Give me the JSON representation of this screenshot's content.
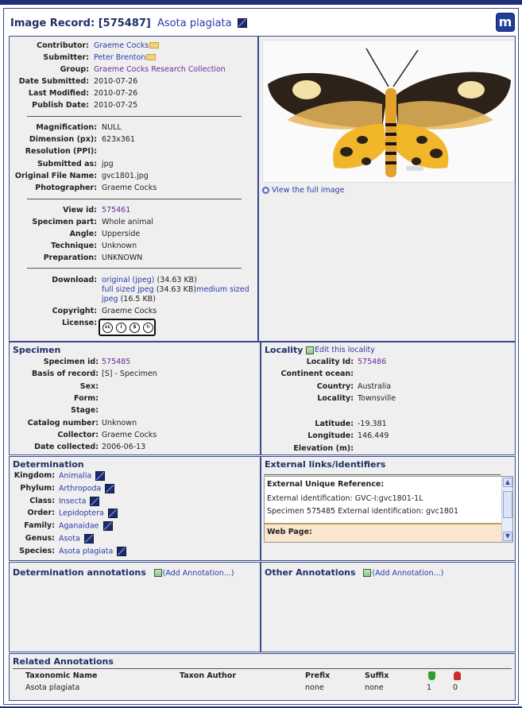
{
  "header": {
    "title": "Image Record: [575487]",
    "scientific_name": "Asota plagiata"
  },
  "record": {
    "contributor": {
      "label": "Contributor:",
      "value": "Graeme Cocks"
    },
    "submitter": {
      "label": "Submitter:",
      "value": "Peter Brenton"
    },
    "group": {
      "label": "Group:",
      "value": "Graeme Cocks Research Collection"
    },
    "date_submitted": {
      "label": "Date Submitted:",
      "value": "2010-07-26"
    },
    "last_modified": {
      "label": "Last Modified:",
      "value": "2010-07-26"
    },
    "publish_date": {
      "label": "Publish Date:",
      "value": "2010-07-25"
    },
    "magnification": {
      "label": "Magnification:",
      "value": "NULL"
    },
    "dimension": {
      "label": "Dimension (px):",
      "value": "623x361"
    },
    "resolution": {
      "label": "Resolution (PPI):",
      "value": ""
    },
    "submitted_as": {
      "label": "Submitted as:",
      "value": "jpg"
    },
    "original_file": {
      "label": "Original File Name:",
      "value": "gvc1801.jpg"
    },
    "photographer": {
      "label": "Photographer:",
      "value": "Graeme Cocks"
    },
    "view_id": {
      "label": "View id:",
      "value": "575461"
    },
    "specimen_part": {
      "label": "Specimen part:",
      "value": "Whole animal"
    },
    "angle": {
      "label": "Angle:",
      "value": "Upperside"
    },
    "technique": {
      "label": "Technique:",
      "value": "Unknown"
    },
    "preparation": {
      "label": "Preparation:",
      "value": "UNKNOWN"
    },
    "download": {
      "label": "Download:",
      "original_link": "original (jpeg)",
      "original_size": "(34.63 KB)",
      "full_link": "full sized jpeg",
      "full_size": "(34.63 KB)",
      "medium_link_1": "medium sized",
      "medium_link_2": "jpeg",
      "medium_size": "(16.5 KB)"
    },
    "copyright": {
      "label": "Copyright:",
      "value": "Graeme Cocks"
    },
    "license": {
      "label": "License:",
      "badge_text": "BY NC SA"
    }
  },
  "image_panel": {
    "view_full_label": "View the full image"
  },
  "specimen": {
    "title": "Specimen",
    "rows": [
      {
        "label": "Specimen id:",
        "value": "575485",
        "link": true
      },
      {
        "label": "Basis of record:",
        "value": "[S] - Specimen",
        "link": false
      },
      {
        "label": "Sex:",
        "value": "",
        "link": false
      },
      {
        "label": "Form:",
        "value": "",
        "link": false
      },
      {
        "label": "Stage:",
        "value": "",
        "link": false
      },
      {
        "label": "Catalog number:",
        "value": "Unknown",
        "link": false
      },
      {
        "label": "Collector:",
        "value": "Graeme Cocks",
        "link": false
      },
      {
        "label": "Date collected:",
        "value": "2006-06-13",
        "link": false
      }
    ]
  },
  "locality": {
    "title": "Locality",
    "edit_label": "Edit this locality",
    "rows": [
      {
        "label": "Locality Id:",
        "value": "575486",
        "link": true
      },
      {
        "label": "Continent ocean:",
        "value": "",
        "link": false
      },
      {
        "label": "Country:",
        "value": "Australia",
        "link": false
      },
      {
        "label": "Locality:",
        "value": "Townsville",
        "link": false
      }
    ],
    "coords": [
      {
        "label": "Latitude:",
        "value": "-19.381"
      },
      {
        "label": "Longitude:",
        "value": "146.449"
      },
      {
        "label": "Elevation (m):",
        "value": ""
      }
    ]
  },
  "determination": {
    "title": "Determination",
    "rows": [
      {
        "label": "Kingdom:",
        "value": "Animalia"
      },
      {
        "label": "Phylum:",
        "value": "Arthropoda"
      },
      {
        "label": "Class:",
        "value": "Insecta"
      },
      {
        "label": "Order:",
        "value": "Lepidoptera"
      },
      {
        "label": "Family:",
        "value": "Aganaidae"
      },
      {
        "label": "Genus:",
        "value": "Asota"
      },
      {
        "label": "Species:",
        "value": "Asota plagiata"
      }
    ]
  },
  "external": {
    "title": "External links/identifiers",
    "unique_ref_label": "External Unique Reference:",
    "line1": "External identification: GVC-I:gvc1801-1L",
    "line2": "Specimen 575485 External identification: gvc1801",
    "web_page_label": "Web Page:"
  },
  "det_annotations": {
    "title": "Determination annotations",
    "add_label": "(Add Annotation...)"
  },
  "other_annotations": {
    "title": "Other Annotations",
    "add_label": "(Add Annotation...)"
  },
  "related": {
    "title": "Related Annotations",
    "headers": {
      "taxonomic_name": "Taxonomic Name",
      "taxon_author": "Taxon Author",
      "prefix": "Prefix",
      "suffix": "Suffix"
    },
    "row": {
      "taxonomic_name": "Asota plagiata",
      "taxon_author": "",
      "prefix": "none",
      "suffix": "none",
      "agree": "1",
      "disagree": "0"
    }
  }
}
